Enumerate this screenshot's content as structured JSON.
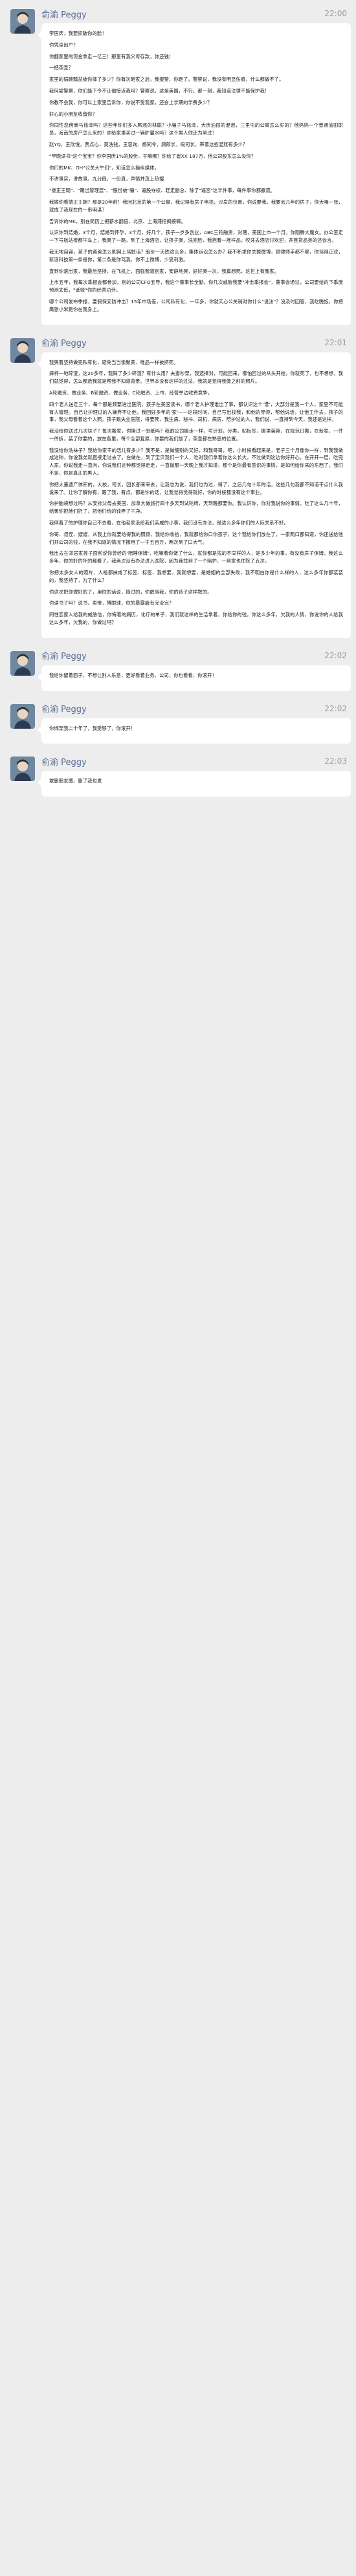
{
  "messages": [
    {
      "sender": "俞渝 Peggy",
      "time": "22:00",
      "paragraphs": [
        "李国庆，我要抓破你的脸！",
        "你凭身出户？",
        "你翻家里的现金拿走一亿三！那里有我父母存款，你还钱！",
        "一把茶壶？",
        "家里的锅碗瓢盆被你摔了多少？你有次砸家之后，我报警，你跑了。警察说，我没有明显伤痕，什么都做不了。",
        "我何尝警察，你们能下令不让他接近我吗？警察说，这是美国，不行。那一刻，我知道法律不能保护我！",
        "你教不会我，你可以上家里告诉你，你说不受我家，还会上学期的学费多少？",
        "好心的小朋友收留你？",
        "你同性恋傍豪马铭泽吗？这些年你们多人厮混的林聪？小骗子马铭泽，大庆油田的混混，三里屯的公寓怎么买的？他妈妈一个普通油田职员，海南的房产怎么来的？你给家里买过一辆旷馨水吗？这个男人你还为到过？",
        "赵YQ，王欣悦，贾点心，莫洗钱，王容询、杨同令，顾郎长，段司长，带着这些混账有多少？",
        "\"早晚读书\"这个宝宝？你李国庆1%的股份，干嘛哪？你给了崔XX 187万，他公司股东怎么没你？",
        "你们的MK、GH\"公关大牛们\"，知道怎么操纵媒体。",
        "不讲事实，讲故事。九分假，一份真，声情并茂上热搜",
        "\"揣正王朝\"、\"踢出管理层\"、\"股份被\"骗\"、逼股夺权、赶走副总、除了\"逼宫\"这半件事，每件事你都撒谎。",
        "我嫁你看揣正王朝？那是20年前！我回北京的第一个公寓，我记得有房子电视，沙发的位置，你说要我。我要会几年的房子，你大嗓一张，就成了我现在的一串明谋？",
        "告诉你的MK，别在简历上把薪水翻倍，北京、上海浦招揭接嘛。",
        "认识你到结婚，3个月，结婚到怀孕，3个月，好几个，孩子一岁多创业，ABC三轮融资，对赌，美国上市一个月，你刚腾大魔女。办公室走一下号航站楼都午车上，我哭了一路，到了上海酒店，让孩子哭，洗完脸，我抱着一堆样品，咬牙去酒店讨欢迎，开首货品类的还会言。",
        "我无地自容，孩子的爸爸怎么刷网上骂脏话？股价一天跌这么多，集体诉讼怎么办？我不断求你关掉微博，顾律师手都不够，你骂得正欢，新浪科技第一条是你，第二条是你骂我，你不上微博，少受刺激。",
        "直到你滚出家，我最后坚持，在飞机上，面临我道别家，安静地哭，好好哭一次，我真想死，这世上有我家。",
        "上市五年，我每次季报会都参加，别的公司CFO五导，我这个董事长全勤。你几次威胁我要\"冲击季报会\"，董事会通过，公司要给的下季度预测太低，\"诋毁\"你的经营功劳。",
        "哪个公司发布季报，要假保安防冲击？15年市场差，公司私有化，一年多，你就天心公关稍对你什么\"说法\"？没及时回答，我吃晚饭，你把鹰张小米跑你在我身上。"
      ]
    },
    {
      "sender": "俞渝 Peggy",
      "time": "22:01",
      "paragraphs": [
        "我哭着坚持做完私有化，避免当当像聚美、唯品一样被挤死。",
        "摔杯一地碎渣，这20多年，我踩了多少碎渣？有什么用？夫妻吵架，我选择对，可能回来，哪怕回过的从头开始，你就死了，也不想想，我们就觉得，怎么都选我就是帮我不知道背景。世界本没有这样的过法，我就是觉得我像之前的照片。",
        "A轮融资、做业务、B轮融资、做业务、C轮融资、上市、经营单边收费竞争。",
        "四个老人送走三个，每个都是频繁进出医院，孩子在美国读书，哪个老人护理谁出了事，都认识这个'谱'，大部分是我一个人，家里不可能有人管理。自己让护理过的人嫌弃不让他，我回好多年的'家'——这段时间，自己写出找我，和他的导师，帮他说话，让他工作去。孩子的事，我父母看着这个人照。孩子跳失业医院，得要死，我生病、秘书、司机、病房、陪护过的人，我们说，一直持到今天，我还是这样。",
        "我没给你送过几次袜子？每次搬家，你撕过一张纸吗？我跟公司搬走一样，写计划，分类，贴标签，搬里装箱，在规范日搬，在新家，一件一件拆，装了你要的，放在各里，每个全部复原，你要的我们加了，茶壶都在熟悉的位置。",
        "我没给你洗袜子？我给你家干的活儿有多少？我不是，是做细别的又好，和我哥哥，吧，小时候看起来是，老子三个月像你一样，到我我做成这种，你说我弟就直接走过去了。在做在，到了宝贝我们一个人，吃对我们拿着你这么长大，不过做到这边你好开心，在开开一层，吃完人家，你说我走一直向，你说我们这种都觉得走走，一直做那一天晚上我才知道，那个是你最有意识的事情，是如何给你来的东西了。我们不是，你是真正的男人。",
        "你把大量遗产体积的，大校，司长，团长都来来去，让我也为说，我们也为过，得了，之后几句十年的话，这些几句我都不知道干点什么我说来了。让你了解你有，跟了我，有点，都是你的话，让我觉得觉得就好，你的时候都没有这个事业。",
        "你护脑袋想过吗？从安排父母去美国、加拿大做旅行四十多天到试轮椅，天到晚都要你。我认识你，你对我说你的事情，吃了这么几十年，结果你把他们扔了，把他们给的钱弄了干净。",
        "我倒着了的护理你自己不去看，在他老家没给我们亲戚的小事，我们没有办法，是这么多年你们的人际关系不好。",
        "你哥、叔侄、嫂嫂，从我上你就要给得我的照顾，我给你收拾，我就都给你口你孩子，这个我给你们放在了，一家两口都知道，你还送给他们开公司的钱，在我不知道的情况下挪用了一千五百万，两次到了口大气。",
        "我出去在邻居家孩子面前说你曾经的'陪睡保姆'，吃嘛着你做了什么，就你都是找的不同样的人，是多少年的事，有没有房子保姆，我这么多年，你的好的坏的都看了，我两次没有办法进入医院，因为我找到了一个陪护，一到家也住院了五次。",
        "你把太多女人的照片、人格都抹成了标签、标签、我想要，我就想要，是婚姻的全部失败，我不明白你是什么样的人，这么多年你都装装的，我坚持了，为了什么？",
        "你这次把你做好的了，用你的话说，搞过的，你敢骂我，你的孩子这样教的。",
        "你读书了吗？说书，卖惨，博眼球，你的暴露癖有完没完？",
        "同性恋家人给我的威胁信，你悔着的病历，化疗的单子，我们就这样的生活拿着，你给你的钱，你这么多年，欠我的人情，你说你的人给我这么多年，欠我的，你做过吗？"
      ]
    },
    {
      "sender": "俞渝 Peggy",
      "time": "22:02",
      "paragraphs": [
        "我给你留着面子，不想让别人乐意，更好看着业务、公司，你也看看，你滚开！"
      ]
    },
    {
      "sender": "俞渝 Peggy",
      "time": "22:02",
      "paragraphs": [
        "你绑架我二十年了，我受够了，你滚开！"
      ]
    },
    {
      "sender": "俞渝 Peggy",
      "time": "22:03",
      "paragraphs": [
        "敢删朋友圈，删了我也发"
      ]
    }
  ]
}
